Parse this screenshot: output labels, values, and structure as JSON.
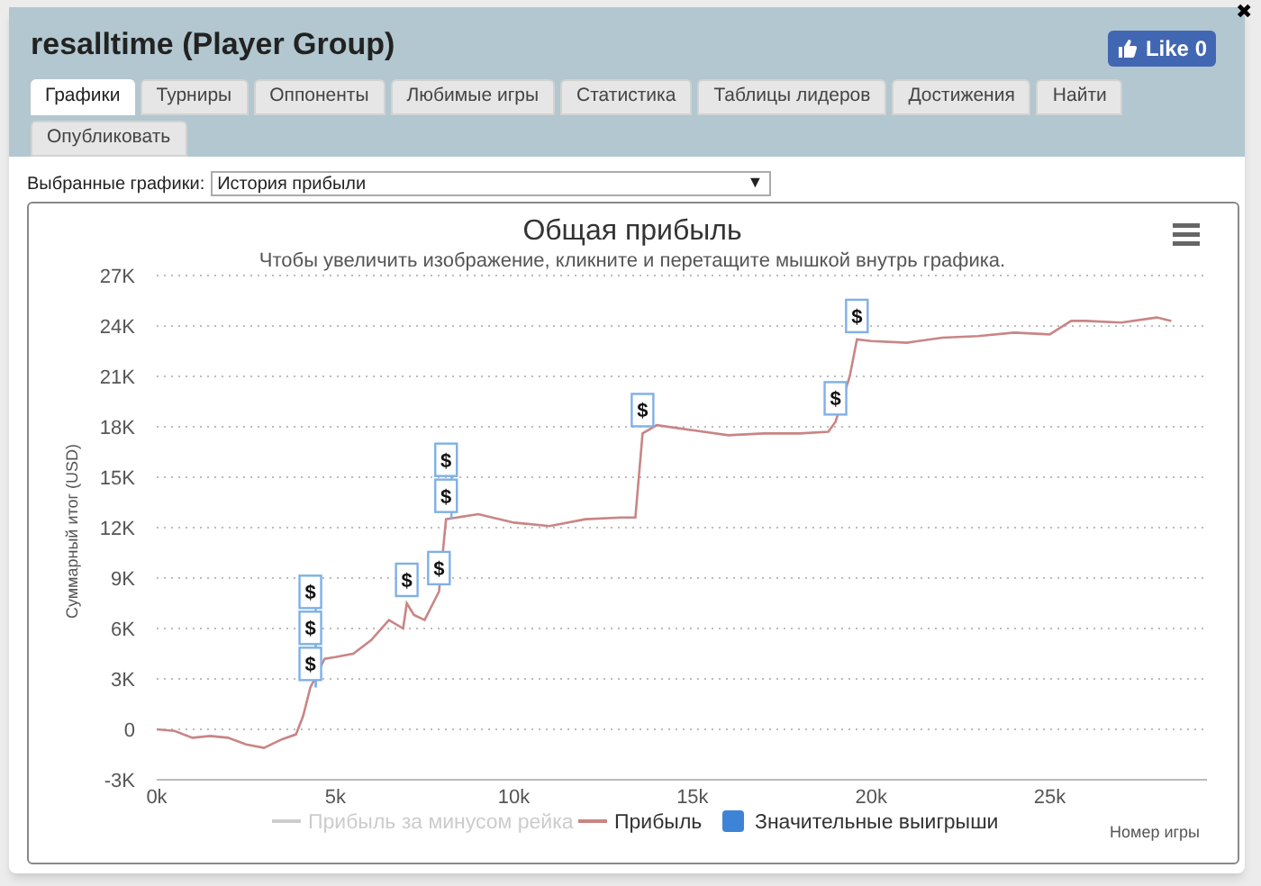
{
  "window": {
    "title": "resalltime (Player Group)",
    "close": "✖"
  },
  "like_button": {
    "label": "Like 0"
  },
  "tabs": [
    {
      "label": "Графики",
      "selected": true
    },
    {
      "label": "Турниры",
      "selected": false
    },
    {
      "label": "Оппоненты",
      "selected": false
    },
    {
      "label": "Любимые игры",
      "selected": false
    },
    {
      "label": "Статистика",
      "selected": false
    },
    {
      "label": "Таблицы лидеров",
      "selected": false
    },
    {
      "label": "Достижения",
      "selected": false
    },
    {
      "label": "Найти",
      "selected": false
    },
    {
      "label": "Опубликовать",
      "selected": false
    }
  ],
  "chart_select": {
    "label": "Выбранные графики:",
    "value": "История прибыли",
    "arrow": "▼"
  },
  "chart": {
    "chart_data": {
      "type": "line",
      "title": "Общая прибыль",
      "subtitle": "Чтобы увеличить изображение, кликните и перетащите мышкой внутрь графика.",
      "xlabel": "Номер игры",
      "ylabel": "Суммарный итог (USD)",
      "xlim": [
        0,
        29400
      ],
      "ylim": [
        -3000,
        27000
      ],
      "xticks": [
        {
          "value": 0,
          "label": "0k"
        },
        {
          "value": 5000,
          "label": "5k"
        },
        {
          "value": 10000,
          "label": "10k"
        },
        {
          "value": 15000,
          "label": "15k"
        },
        {
          "value": 20000,
          "label": "20k"
        },
        {
          "value": 25000,
          "label": "25k"
        }
      ],
      "yticks": [
        {
          "value": -3000,
          "label": "-3K"
        },
        {
          "value": 0,
          "label": "0"
        },
        {
          "value": 3000,
          "label": "3K"
        },
        {
          "value": 6000,
          "label": "6K"
        },
        {
          "value": 9000,
          "label": "9K"
        },
        {
          "value": 12000,
          "label": "12K"
        },
        {
          "value": 15000,
          "label": "15K"
        },
        {
          "value": 18000,
          "label": "18K"
        },
        {
          "value": 21000,
          "label": "21K"
        },
        {
          "value": 24000,
          "label": "24K"
        },
        {
          "value": 27000,
          "label": "27K"
        }
      ],
      "x": [
        0,
        500,
        1000,
        1500,
        2000,
        2500,
        3000,
        3500,
        3900,
        4100,
        4300,
        4700,
        5000,
        5500,
        6000,
        6500,
        6900,
        7000,
        7200,
        7500,
        7900,
        8100,
        9000,
        10000,
        11000,
        12000,
        13000,
        13400,
        13600,
        14000,
        15000,
        16000,
        17000,
        18000,
        18800,
        19000,
        19400,
        19600,
        20000,
        21000,
        22000,
        23000,
        24000,
        25000,
        25600,
        26000,
        27000,
        28000,
        28400
      ],
      "series": [
        {
          "name": "Прибыль",
          "color": "#c98585",
          "values": [
            0,
            -100,
            -500,
            -400,
            -500,
            -900,
            -1100,
            -600,
            -300,
            800,
            2500,
            4200,
            4300,
            4500,
            5300,
            6500,
            6000,
            7500,
            6800,
            6500,
            8200,
            12500,
            12800,
            12300,
            12100,
            12500,
            12600,
            12600,
            17600,
            18100,
            17800,
            17500,
            17600,
            17600,
            17700,
            18300,
            21000,
            23200,
            23100,
            23000,
            23300,
            23400,
            23600,
            23500,
            24300,
            24300,
            24200,
            24500,
            24300
          ]
        }
      ],
      "grid": true,
      "annotations": [
        {
          "x": 4300,
          "y": 2500,
          "text": "$"
        },
        {
          "x": 4300,
          "y": 2500,
          "text": "$"
        },
        {
          "x": 4300,
          "y": 2500,
          "text": "$"
        },
        {
          "x": 7000,
          "y": 7500,
          "text": "$"
        },
        {
          "x": 7900,
          "y": 8200,
          "text": "$"
        },
        {
          "x": 8100,
          "y": 12500,
          "text": "$"
        },
        {
          "x": 8100,
          "y": 12500,
          "text": "$"
        },
        {
          "x": 13600,
          "y": 17600,
          "text": "$"
        },
        {
          "x": 19000,
          "y": 18300,
          "text": "$"
        },
        {
          "x": 19600,
          "y": 23200,
          "text": "$"
        }
      ]
    },
    "legend": [
      {
        "label": "Прибыль за минусом рейка",
        "kind": "line",
        "color": "#cccccc",
        "visible": false
      },
      {
        "kind": "series",
        "visible": true
      },
      {
        "label": "Значительные выигрыши",
        "kind": "square",
        "color": "#3d84d6",
        "visible": true
      }
    ]
  }
}
